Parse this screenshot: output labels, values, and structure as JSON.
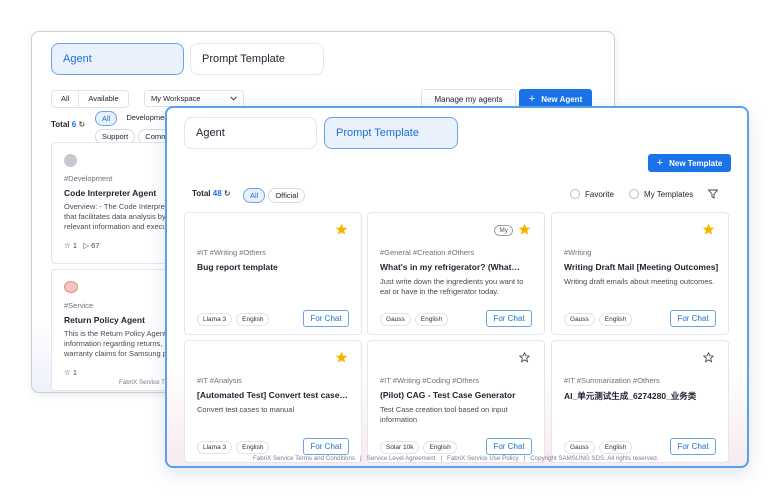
{
  "back": {
    "tabs": [
      "Agent",
      "Prompt Template"
    ],
    "filter_all": "All",
    "filter_available": "Available",
    "workspace_select": "My Workspace",
    "manage_label": "Manage my agents",
    "new_agent_label": "New Agent",
    "total_label": "Total",
    "total_count": "6",
    "categories": [
      "All",
      "Development",
      "Support",
      "Comm"
    ],
    "agents": [
      {
        "tag": "#Development",
        "title": "Code Interpreter Agent",
        "desc_lines": [
          "Overview: - The Code Interpret",
          "that facilitates data analysis by",
          "relevant information and execu"
        ],
        "likes": "1",
        "uses": "67"
      },
      {
        "tag": "#Service",
        "title": "Return Policy Agent",
        "desc_lines": [
          "This is the Return Policy Agent,",
          "information regarding returns,",
          "warranty claims for Samsung p"
        ],
        "likes": "1",
        "uses": ""
      }
    ],
    "footer": "FabriX Service T"
  },
  "front": {
    "tabs": [
      "Agent",
      "Prompt Template"
    ],
    "new_template_label": "New Template",
    "total_label": "Total",
    "total_count": "48",
    "filters": [
      "All",
      "Official"
    ],
    "favorite_label": "Favorite",
    "my_templates_label": "My Templates",
    "cards": [
      {
        "tags": "#IT #Writing #Others",
        "title": "Bug report template",
        "desc": "",
        "chips": [
          "Llama 3",
          "English"
        ],
        "starred": true,
        "my": false
      },
      {
        "tags": "#General #Creation #Others",
        "title": "What's in my refrigerator? (What…",
        "desc": "Just write down the ingredients you want to eat or have in the refrigerator today.",
        "chips": [
          "Gauss",
          "English"
        ],
        "starred": true,
        "my": true
      },
      {
        "tags": "#Writing",
        "title": "Writing Draft Mail [Meeting Outcomes]",
        "desc": "Writing draft emails about meeting outcomes.",
        "chips": [
          "Gauss",
          "English"
        ],
        "starred": true,
        "my": false
      },
      {
        "tags": "#IT #Analysis",
        "title": "[Automated Test] Convert test cases…",
        "desc": "Convert test cases to manual",
        "chips": [
          "Llama 3",
          "English"
        ],
        "starred": true,
        "my": false
      },
      {
        "tags": "#IT #Writing #Coding #Others",
        "title": "(Pilot) CAG - Test Case Generator",
        "desc": "Test Case creation tool based on input information",
        "chips": [
          "Solar 10k",
          "English"
        ],
        "starred": false,
        "my": false
      },
      {
        "tags": "#IT #Summarization #Others",
        "title": "AI_单元测试生成_6274280_业务类",
        "desc": "",
        "chips": [
          "Gauss",
          "English"
        ],
        "starred": false,
        "my": false
      }
    ],
    "my_badge": "My",
    "for_chat_label": "For Chat",
    "footer_links": [
      "FabriX Service Terms and Conditions",
      "Service Level Agreement",
      "FabriX Service Use Policy",
      "Copyright SAMSUNG SDS. All rights reserved."
    ]
  },
  "colors": {
    "accent": "#1a73e8",
    "star": "#f5b400",
    "active_tab_bg": "#e8f1fc"
  }
}
